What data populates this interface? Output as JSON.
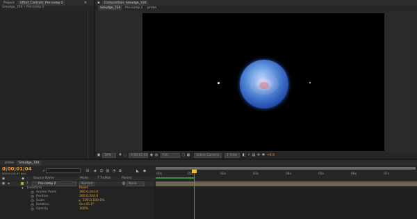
{
  "project_panel": {
    "tabs": [
      "Project",
      "Effect Controls: Pre-comp 2"
    ],
    "breadcrumb": "Smudge_720 • Pre-comp 2"
  },
  "comp_panel": {
    "tab": "Composition: Smudge_720",
    "viewer_tabs": [
      "Smudge_720",
      "Pre-comp 2",
      "probe"
    ],
    "zoom": "50%",
    "timecode": "0;00;01;04",
    "resolution": "Full",
    "camera": "Active Camera",
    "views": "1 View",
    "exposure": "+0.0"
  },
  "timeline": {
    "tabs": [
      "probe",
      "Smudge_720"
    ],
    "timecode": "0;00;01;04",
    "frame_info": "00034 (29.97 fps)",
    "columns": {
      "source_name": "Source Name",
      "mode": "Mode",
      "trkmat": "T TrkMat",
      "parent": "Parent"
    },
    "layer": {
      "index": "1",
      "name": "Pre-comp 2",
      "mode": "Normal",
      "parent": "None"
    },
    "properties": [
      {
        "name": "Transform",
        "value": "Reset"
      },
      {
        "name": "Anchor Point",
        "value": "360.0,243.0"
      },
      {
        "name": "Position",
        "value": "360.0,244.0"
      },
      {
        "name": "Scale",
        "value": "100.0,100.0%"
      },
      {
        "name": "Rotation",
        "value": "0x+45.0°"
      },
      {
        "name": "Opacity",
        "value": "100%"
      }
    ],
    "ruler_labels": [
      "00s",
      "05s",
      "02s",
      "03s",
      "04s",
      "05s",
      "06s",
      "07s"
    ]
  },
  "colors": {
    "accent": "#e9a23b",
    "playhead": "#e05a3a",
    "workbar": "#6a6a6a"
  }
}
